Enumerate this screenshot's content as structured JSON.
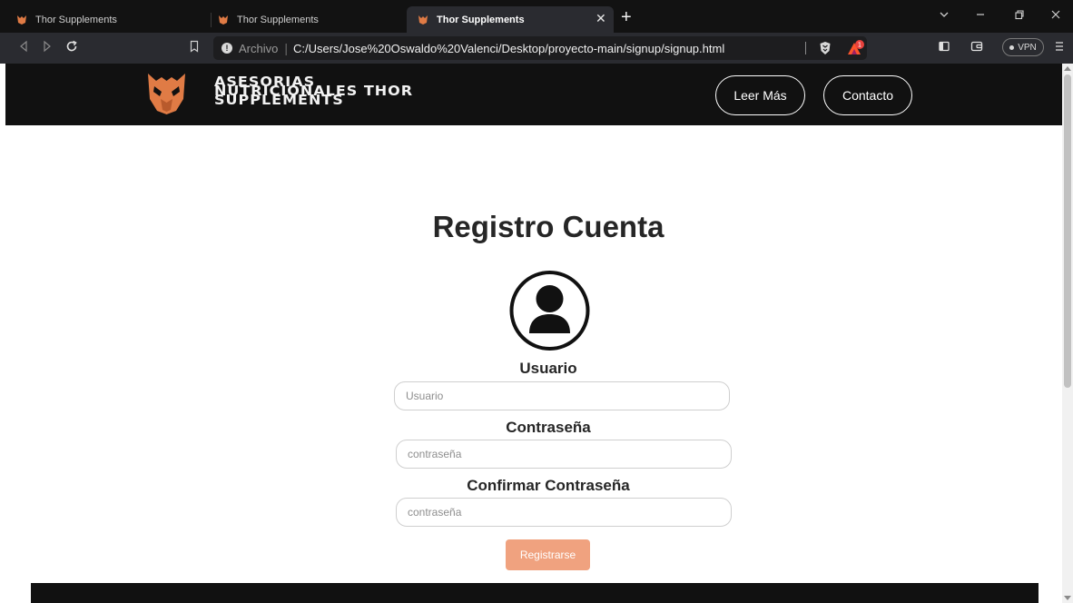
{
  "browser": {
    "tabs": [
      {
        "title": "Thor Supplements",
        "active": false
      },
      {
        "title": "Thor Supplements",
        "active": false
      },
      {
        "title": "Thor Supplements",
        "active": true
      }
    ],
    "url_scheme": "Archivo",
    "url": "C:/Users/Jose%20Oswaldo%20Valenci/Desktop/proyecto-main/signup/signup.html",
    "vpn_label": "VPN",
    "rewards_badge": "1"
  },
  "header": {
    "brand_lines": [
      "ASESORIAS",
      "NUTRICIONALES THOR",
      "SUPPLEMENTS"
    ],
    "nav": {
      "read_more": "Leer Más",
      "contact": "Contacto"
    }
  },
  "form": {
    "title": "Registro Cuenta",
    "username_label": "Usuario",
    "username_placeholder": "Usuario",
    "password_label": "Contraseña",
    "password_placeholder": "contraseña",
    "confirm_label": "Confirmar Contraseña",
    "confirm_placeholder": "contraseña",
    "submit_label": "Registrarse"
  },
  "colors": {
    "header_bg": "#111111",
    "accent": "#f0a27f",
    "logo_orange": "#e07b45",
    "browser_bg": "#2a2b30"
  }
}
